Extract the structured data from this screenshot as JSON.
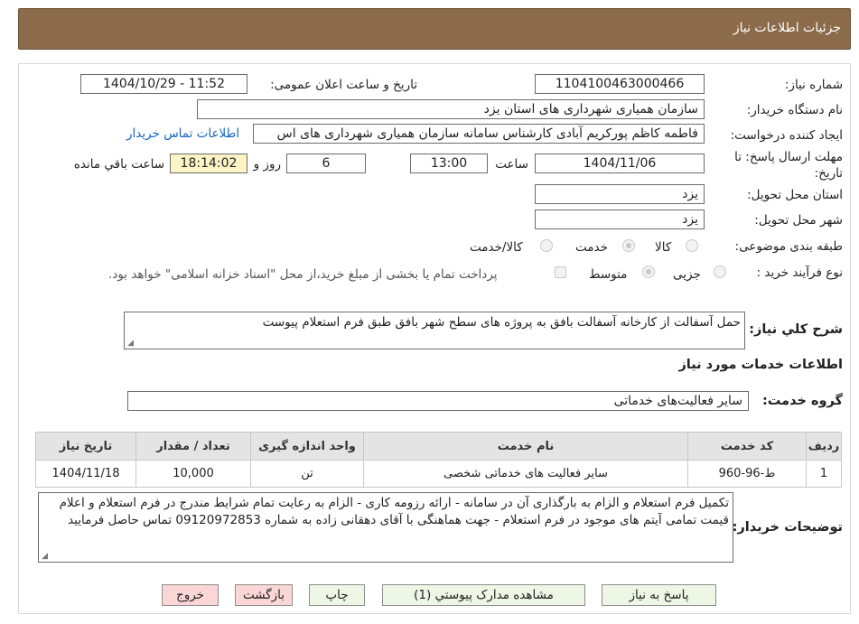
{
  "header": {
    "title": "جزئیات اطلاعات نیاز"
  },
  "fields": {
    "need_number_label": "شماره نیاز:",
    "need_number": "1104100463000466",
    "announce_label": "تاریخ و ساعت اعلان عمومی:",
    "announce_value": "1404/10/29 - 11:52",
    "buyer_org_label": "نام دستگاه خریدار:",
    "buyer_org": "سازمان همیاری شهرداری های استان یزد",
    "creator_label": "ایجاد کننده درخواست:",
    "creator": "فاطمه کاظم پورکریم آبادی کارشناس سامانه سازمان همیاری شهرداری های اس",
    "contact_link": "اطلاعات تماس خریدار",
    "deadline_label_1": "مهلت ارسال پاسخ: تا",
    "deadline_label_2": "تاریخ:",
    "deadline_date": "1404/11/06",
    "time_label": "ساعت",
    "deadline_time": "13:00",
    "days_value": "6",
    "days_label": "روز و",
    "remaining_time": "18:14:02",
    "remaining_label": "ساعت باقي مانده",
    "province_label": "استان محل تحویل:",
    "province": "یزد",
    "city_label": "شهر محل تحویل:",
    "city": "یزد",
    "category_label": "طبقه بندی موضوعی:",
    "category_options": [
      "کالا",
      "خدمت",
      "کالا/خدمت"
    ],
    "category_selected": "خدمت",
    "process_label": "نوع فرآیند خرید :",
    "process_options": [
      "جزیی",
      "متوسط"
    ],
    "process_selected": "متوسط",
    "treasury_note": "پرداخت تمام یا بخشی از مبلغ خرید،از محل \"اسناد خزانه اسلامی\" خواهد بود.",
    "summary_label": "شرح کلي نياز:",
    "summary": "حمل آسفالت از کارخانه آسفالت بافق به پروژه های سطح شهر بافق طبق فرم استعلام پیوست"
  },
  "services": {
    "section_title": "اطلاعات خدمات مورد نیاز",
    "group_label": "گروه خدمت:",
    "group_value": "سایر فعالیت‌های خدماتی",
    "columns": [
      "ردیف",
      "کد خدمت",
      "نام خدمت",
      "واحد اندازه گیری",
      "تعداد / مقدار",
      "تاریخ نیاز"
    ],
    "rows": [
      [
        "1",
        "ط-96-960",
        "سایر فعالیت های خدماتی شخصی",
        "تن",
        "10,000",
        "1404/11/18"
      ]
    ]
  },
  "buyer_notes": {
    "label": "توضیحات خریدار:",
    "text": "تکمیل فرم استعلام و الزام به بارگذاری آن در سامانه - ارائه رزومه کاری - الزام به رعایت تمام شرایط مندرج در فرم استعلام و اعلام قیمت تمامی آیتم های موجود در فرم استعلام - جهت هماهنگی با آقای  دهقانی زاده به شماره 09120972853 تماس حاصل فرمایید"
  },
  "buttons": {
    "reply": "پاسخ به نیاز",
    "attachments": "مشاهده مدارک پیوستي (1)",
    "print": "چاپ",
    "back": "بازگشت",
    "exit": "خروج"
  },
  "colors": {
    "header_bg": "#8b6b4a",
    "remaining_bg": "#fcf4c4",
    "link": "#1565c0",
    "btn_green": "#eef6e6",
    "btn_red": "#fbd6d6"
  }
}
